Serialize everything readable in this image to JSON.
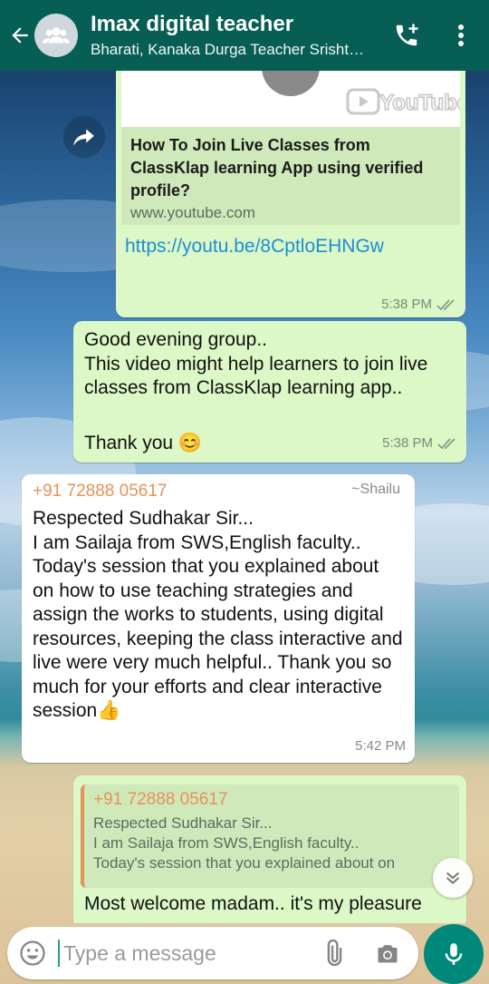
{
  "header": {
    "title": "Imax digital teacher",
    "subtitle": "Bharati, Kanaka Durga Teacher Srisht…"
  },
  "messages": {
    "link_message": {
      "preview_brand": "YouTube",
      "preview_title": "How To Join Live Classes from ClassKlap learning App using verified profile?",
      "preview_domain": "www.youtube.com",
      "link": "https://youtu.be/8CptloEHNGw",
      "time": "5:38 PM"
    },
    "greeting_message": {
      "line1": "Good evening group..",
      "line2": "This video might help learners to join live classes from ClassKlap learning app..",
      "line3": "Thank you 😊",
      "time": "5:38 PM"
    },
    "incoming_message": {
      "sender_phone": "+91 72888 05617",
      "sender_name": "~Shailu",
      "text": "Respected Sudhakar Sir...\nI am Sailaja from SWS,English faculty..\nToday's session that you explained about on how to use teaching strategies and assign the works to students, using digital resources, keeping the class interactive and live were very much helpful.. Thank you so much for your efforts and  clear interactive session👍",
      "time": "5:42 PM"
    },
    "reply_message": {
      "quote_phone": "+91 72888 05617",
      "quote_line1": "Respected Sudhakar Sir...",
      "quote_line2": "I am Sailaja from SWS,English faculty..",
      "quote_line3": "Today's session that you explained about on",
      "text": "Most welcome madam.. it's my pleasure"
    }
  },
  "input": {
    "placeholder": "Type a message"
  },
  "colors": {
    "header": "#075e54",
    "outgoing_bubble": "#dcf8c6",
    "incoming_bubble": "#ffffff",
    "accent": "#00897b",
    "link": "#1c8ed6",
    "sender": "#e9915a"
  },
  "icons": [
    "back-arrow-icon",
    "group-avatar-icon",
    "add-call-icon",
    "more-vert-icon",
    "forward-icon",
    "youtube-logo",
    "double-check-icon",
    "scroll-down-icon",
    "emoji-icon",
    "attach-icon",
    "camera-icon",
    "mic-icon"
  ]
}
